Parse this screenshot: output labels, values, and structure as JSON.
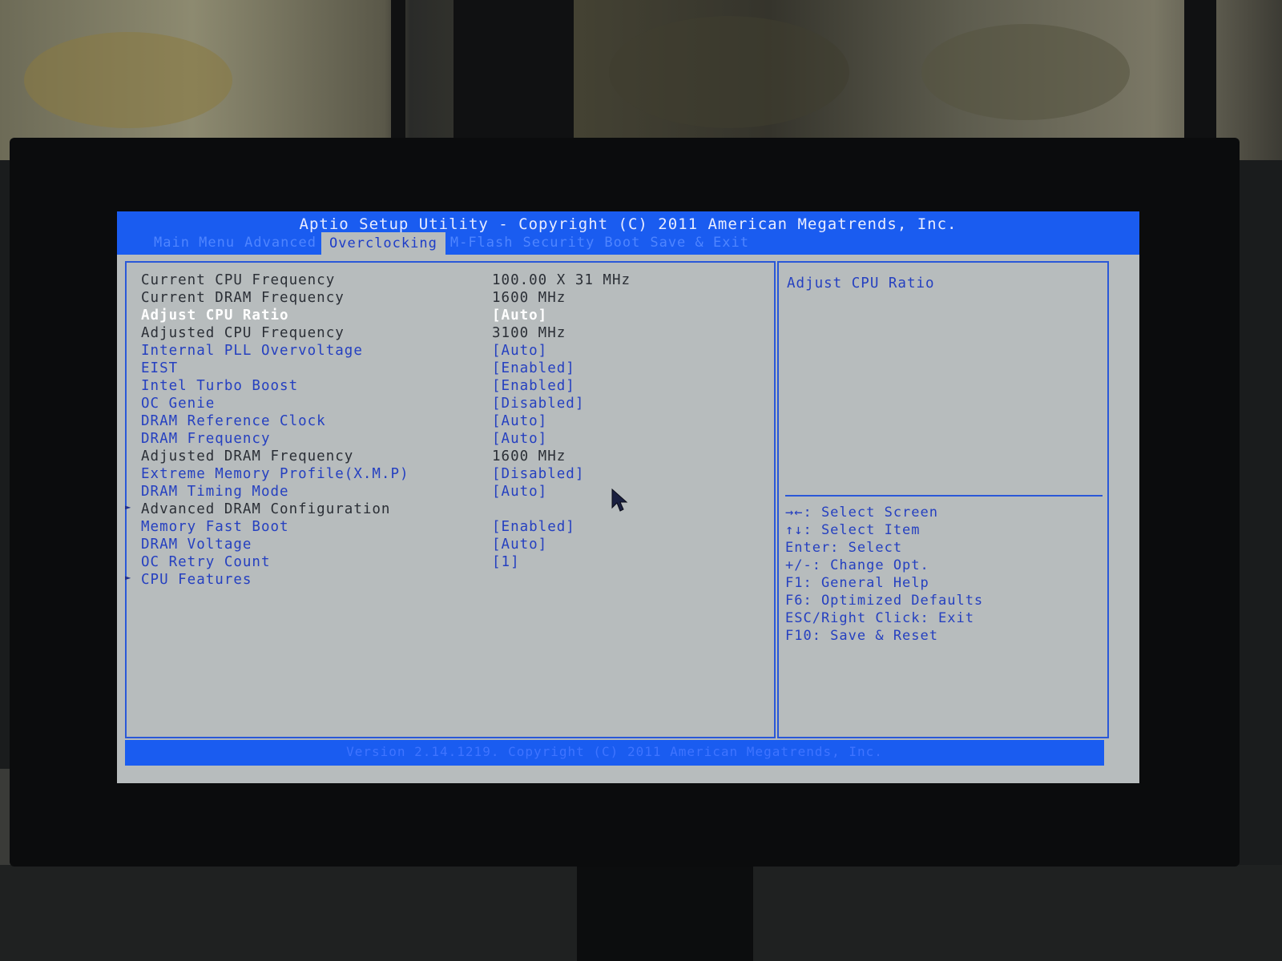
{
  "header": {
    "title": "Aptio Setup Utility - Copyright (C) 2011 American Megatrends, Inc."
  },
  "tabs": [
    {
      "label": "Main Menu",
      "active": false
    },
    {
      "label": "Advanced",
      "active": false
    },
    {
      "label": "Overclocking",
      "active": true
    },
    {
      "label": "M-Flash",
      "active": false
    },
    {
      "label": "Security",
      "active": false
    },
    {
      "label": "Boot",
      "active": false
    },
    {
      "label": "Save & Exit",
      "active": false
    }
  ],
  "settings": [
    {
      "label": "Current CPU Frequency",
      "value": "100.00 X 31 MHz"
    },
    {
      "label": "Current DRAM Frequency",
      "value": "1600 MHz"
    },
    {
      "label": "Adjust CPU Ratio",
      "value": "[Auto]"
    },
    {
      "label": "Adjusted CPU Frequency",
      "value": "3100 MHz"
    },
    {
      "label": "Internal PLL Overvoltage",
      "value": "[Auto]"
    },
    {
      "label": "EIST",
      "value": "[Enabled]"
    },
    {
      "label": "Intel Turbo Boost",
      "value": "[Enabled]"
    },
    {
      "label": "OC Genie",
      "value": "[Disabled]"
    },
    {
      "label": "DRAM Reference Clock",
      "value": "[Auto]"
    },
    {
      "label": "DRAM Frequency",
      "value": "[Auto]"
    },
    {
      "label": "Adjusted DRAM Frequency",
      "value": "1600 MHz"
    },
    {
      "label": "Extreme Memory Profile(X.M.P)",
      "value": "[Disabled]"
    },
    {
      "label": "DRAM Timing Mode",
      "value": "[Auto]"
    },
    {
      "label": "Advanced DRAM Configuration",
      "value": ""
    },
    {
      "label": "Memory Fast Boot",
      "value": "[Enabled]"
    },
    {
      "label": "DRAM Voltage",
      "value": "[Auto]"
    },
    {
      "label": "OC Retry Count",
      "value": "[1]"
    },
    {
      "label": "CPU Features",
      "value": ""
    }
  ],
  "submenu_arrow": "►",
  "help": {
    "title": "Adjust CPU Ratio",
    "keys": [
      "→←: Select Screen",
      "↑↓: Select Item",
      "Enter: Select",
      "+/-: Change Opt.",
      "F1: General Help",
      "F6: Optimized Defaults",
      "ESC/Right Click: Exit",
      "F10: Save & Reset"
    ]
  },
  "footer": {
    "version": "Version 2.14.1219. Copyright (C) 2011 American Megatrends, Inc."
  },
  "colors": {
    "bar_blue": "#1a5cf0",
    "panel_gray": "#b7bcbd",
    "option_blue": "#2540c0",
    "highlight": "#ffffff"
  }
}
